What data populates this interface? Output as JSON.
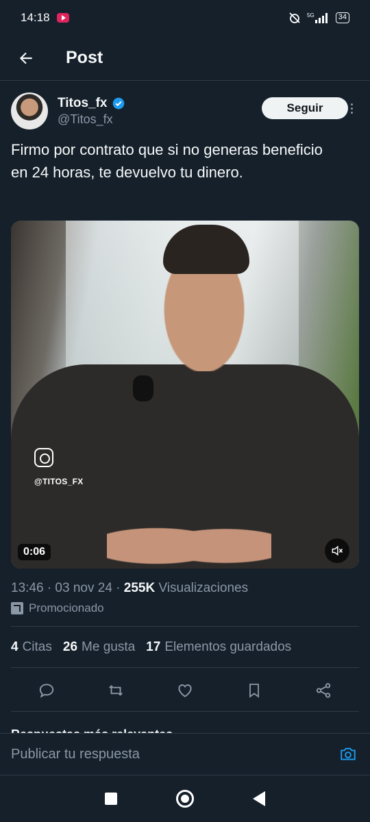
{
  "status_bar": {
    "time": "14:18",
    "network": "5G",
    "battery": "34"
  },
  "header": {
    "title": "Post"
  },
  "tweet": {
    "author_name": "Titos_fx",
    "author_handle": "@Titos_fx",
    "follow_label": "Seguir",
    "text": "Firmo por contrato que si no generas beneficio en 24 horas, te devuelvo tu dinero.",
    "video": {
      "watermark_handle": "@TITOS_FX",
      "duration": "0:06"
    },
    "timestamp": "13:46 · 03 nov 24 · ",
    "views_count": "255K",
    "views_label": " Visualizaciones",
    "promoted_label": "Promocionado"
  },
  "stats": {
    "quotes_count": "4",
    "quotes_label": "Citas",
    "likes_count": "26",
    "likes_label": "Me gusta",
    "bookmarks_count": "17",
    "bookmarks_label": "Elementos guardados"
  },
  "replies": {
    "sort_label": "Respuestas más relevantes"
  },
  "compose": {
    "placeholder": "Publicar tu respuesta"
  },
  "colors": {
    "background": "#15202b",
    "verified": "#1d9bf0",
    "muted_text": "#8b98a5"
  }
}
